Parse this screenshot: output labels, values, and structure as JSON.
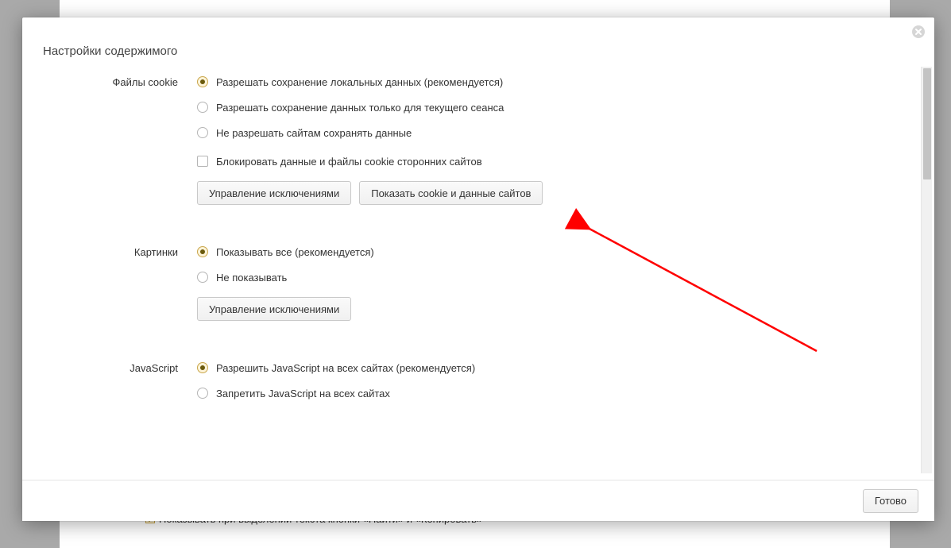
{
  "bg": {
    "cut_text": "Показывать при выделении текста кнопки «Найти» и «Копировать»"
  },
  "dialog": {
    "title": "Настройки содержимого",
    "close_aria": "Закрыть"
  },
  "cookies": {
    "heading": "Файлы cookie",
    "opt_allow": "Разрешать сохранение локальных данных (рекомендуется)",
    "opt_session": "Разрешать сохранение данных только для текущего сеанса",
    "opt_block": "Не разрешать сайтам сохранять данные",
    "opt_third_party": "Блокировать данные и файлы cookie сторонних сайтов",
    "btn_exceptions": "Управление исключениями",
    "btn_show_cookies": "Показать cookie и данные сайтов"
  },
  "images": {
    "heading": "Картинки",
    "opt_show_all": "Показывать все (рекомендуется)",
    "opt_hide": "Не показывать",
    "btn_exceptions": "Управление исключениями"
  },
  "javascript": {
    "heading": "JavaScript",
    "opt_allow": "Разрешить JavaScript на всех сайтах (рекомендуется)",
    "opt_block": "Запретить JavaScript на всех сайтах"
  },
  "footer": {
    "done": "Готово"
  }
}
